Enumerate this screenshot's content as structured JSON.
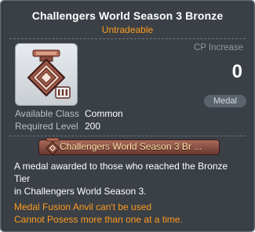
{
  "tooltip": {
    "title": "Challengers World Season 3 Bronze",
    "subtitle": "Untradeable",
    "item_icon": "challengers-bronze-medal-icon",
    "cp_label": "CP Increase",
    "cp_value": "0",
    "category_badge": "Medal",
    "info": [
      {
        "key": "Available Class",
        "value": "Common"
      },
      {
        "key": "Required Level",
        "value": "200"
      }
    ],
    "set_banner": {
      "icon": "medal-set-icon",
      "label": "Challengers World Season 3 Br ..."
    },
    "description_lines": [
      "A medal awarded to those who reached the Bronze",
      "Tier",
      "in Challengers World Season 3."
    ],
    "warnings": [
      "Medal Fusion Anvil can't be used",
      "Cannot Posess more than one at a time."
    ],
    "colors": {
      "panel_bg": "#3a4046",
      "accent_orange": "#ff9a1f",
      "banner_red": "#8a4a3e"
    }
  }
}
